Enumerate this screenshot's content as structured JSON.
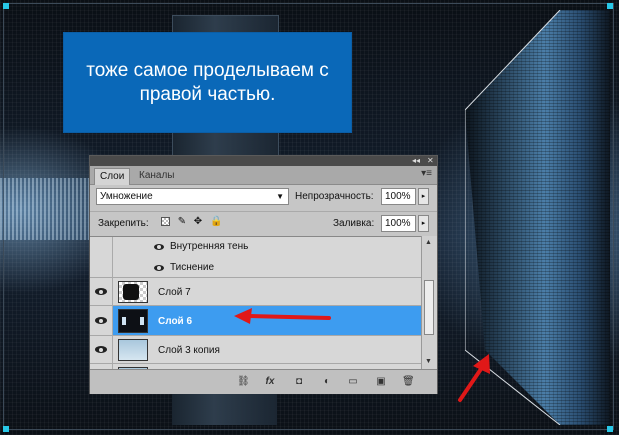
{
  "note": {
    "text": "тоже самое проделываем с\nправой частью."
  },
  "palette": {
    "collapse_glyph": "◂◂",
    "close_glyph": "✕",
    "tabs": [
      {
        "label": "Слои",
        "active": true
      },
      {
        "label": "Каналы",
        "active": false
      }
    ],
    "menu_glyph": "▾≡",
    "blend_mode": {
      "value": "Умножение",
      "arrow": "▼"
    },
    "opacity": {
      "label": "Непрозрачность:",
      "value": "100%",
      "arrow": "▸"
    },
    "lock": {
      "label": "Закрепить:"
    },
    "fill": {
      "label": "Заливка:",
      "value": "100%",
      "arrow": "▸"
    },
    "effects": [
      {
        "label": "Внутренняя тень"
      },
      {
        "label": "Тиснение"
      }
    ],
    "layers": [
      {
        "name": "Слой 7",
        "selected": false
      },
      {
        "name": "Слой 6",
        "selected": true
      },
      {
        "name": "Слой 3 копия",
        "selected": false
      }
    ],
    "scroll": {
      "up": "▲",
      "down": "▼"
    },
    "footer_icons": [
      "link-layers-icon",
      "fx-icon",
      "add-mask-icon",
      "adjustment-layer-icon",
      "new-group-icon",
      "new-layer-icon",
      "delete-layer-icon"
    ],
    "footer_glyphs": {
      "link": "⛓",
      "fx": "fx",
      "mask": "◘",
      "adjust": "◐",
      "group": "▭",
      "new": "▣",
      "delete": "🗑"
    }
  },
  "colors": {
    "note_bg": "#0a68b8",
    "selected_row": "#3d9cf0",
    "arrow": "#e01818",
    "accent_corner": "#28c8e8"
  }
}
